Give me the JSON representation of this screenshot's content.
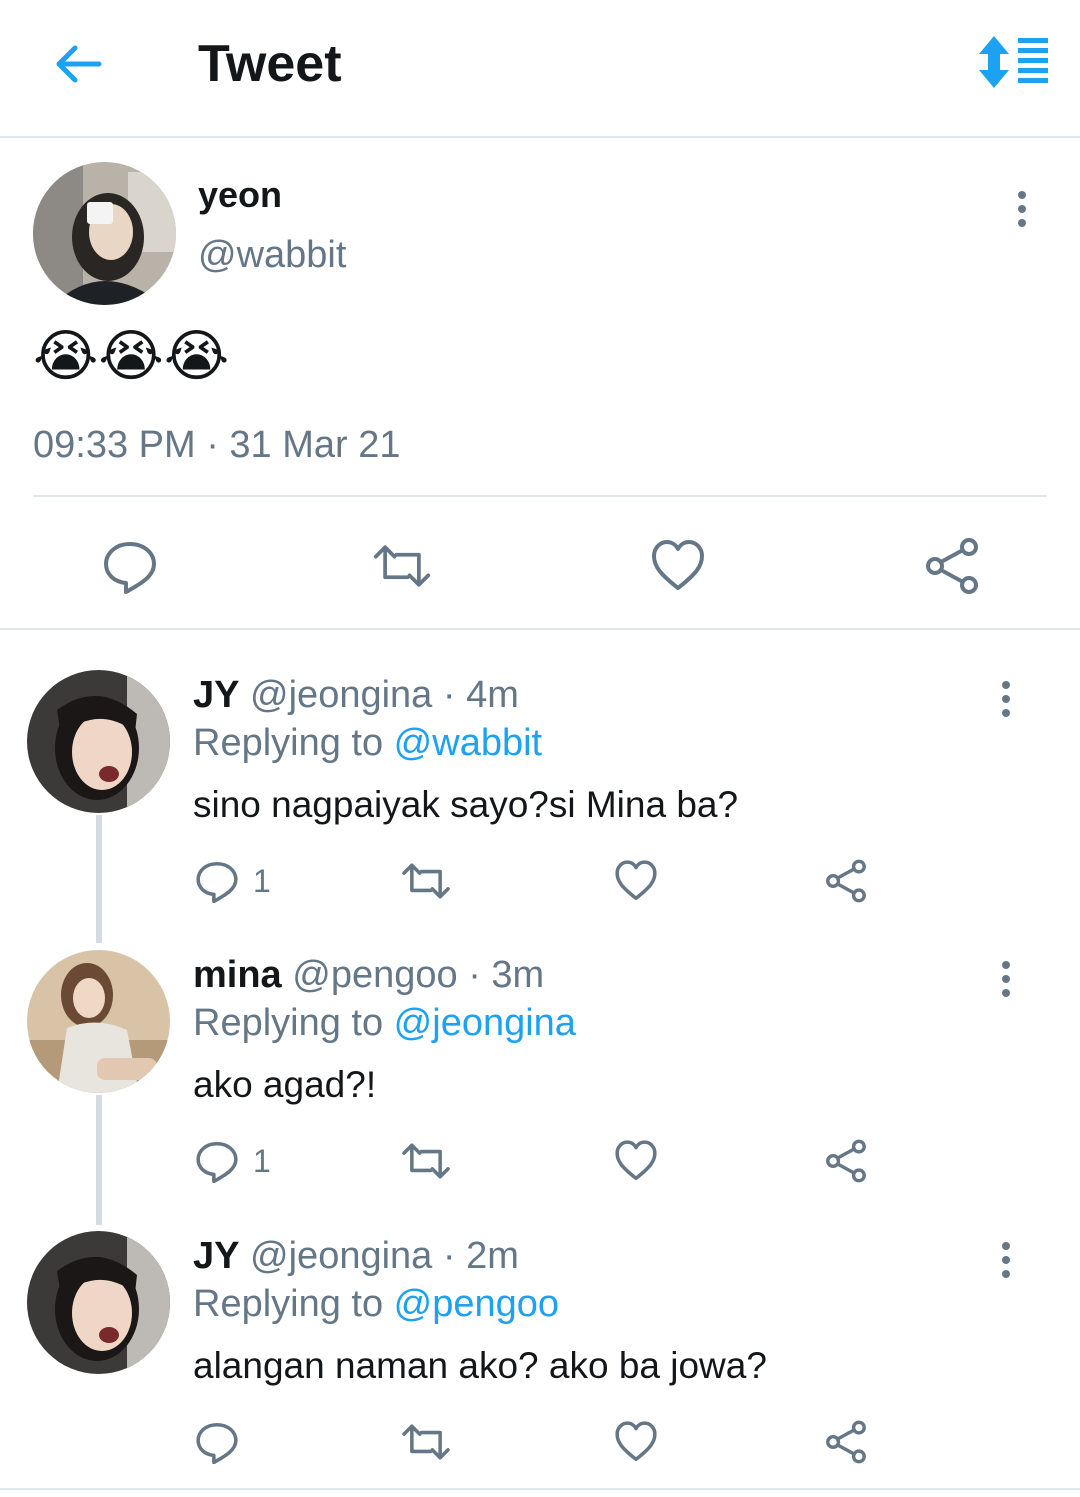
{
  "header": {
    "title": "Tweet",
    "back_icon": "arrow-left-icon",
    "sort_icon": "sort-list-icon",
    "accent": "#1da1f2"
  },
  "main_tweet": {
    "name": "yeon",
    "handle": "@wabbit",
    "text": "😭😭😭",
    "timestamp": "09:33 PM · 31 Mar 21"
  },
  "replies": [
    {
      "name": "JY",
      "meta": " @jeongina · 4m",
      "replying_label": "Replying to ",
      "replying_to": "@wabbit",
      "text": "sino nagpaiyak sayo?si Mina ba?",
      "reply_count": "1"
    },
    {
      "name": "mina",
      "meta": " @pengoo · 3m",
      "replying_label": "Replying to ",
      "replying_to": "@jeongina",
      "text": "ako agad?!",
      "reply_count": "1"
    },
    {
      "name": "JY",
      "meta": " @jeongina · 2m",
      "replying_label": "Replying to ",
      "replying_to": "@pengoo",
      "text": "alangan naman ako? ako ba jowa?",
      "reply_count": ""
    }
  ],
  "colors": {
    "text": "#14171a",
    "secondary": "#657786",
    "link": "#1da1f2",
    "divider": "#e1e8ed"
  }
}
